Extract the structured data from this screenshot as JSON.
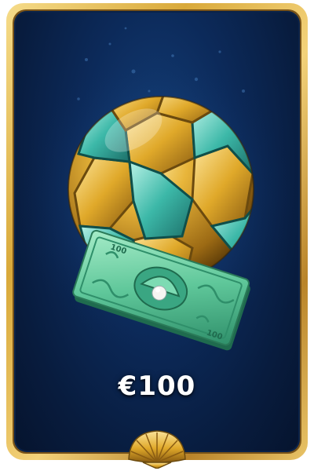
{
  "card": {
    "prize_amount": "€100",
    "reward_icon": "football-with-banknote-icon",
    "ornament_icon": "scallop-shell-icon"
  },
  "colors": {
    "frame_gold": "#d9a93a",
    "background_navy": "#0c2a5a",
    "ball_gold": "#e0a92a",
    "ball_teal": "#3cb8a8",
    "banknote_green": "#5fc79a"
  }
}
